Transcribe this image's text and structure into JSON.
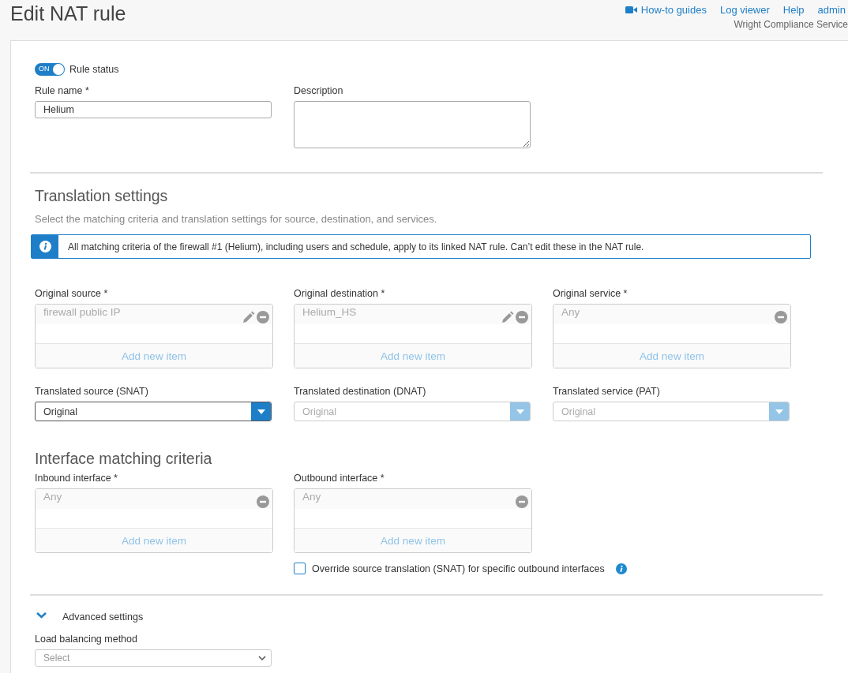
{
  "header": {
    "title": "Edit NAT rule",
    "links": [
      {
        "label": "How-to guides",
        "kind": "video"
      },
      {
        "label": "Log viewer",
        "kind": "plain"
      },
      {
        "label": "Help",
        "kind": "plain"
      },
      {
        "label": "admin",
        "kind": "plain"
      }
    ],
    "account": "Wright Compliance Service"
  },
  "rule_status": {
    "label": "Rule status",
    "toggle_text": "ON",
    "on": true
  },
  "rule_name": {
    "label": "Rule name *",
    "value": "Helium"
  },
  "description": {
    "label": "Description"
  },
  "translation": {
    "heading": "Translation settings",
    "subtitle": "Select the matching criteria and translation settings for source, destination, and services.",
    "notice": "All matching criteria of the firewall #1 (Helium), including users and schedule, apply to its linked NAT rule. Can’t edit these in the NAT rule.",
    "pickers": [
      {
        "label": "Original source *",
        "item": "firewall public IP",
        "editable": true,
        "add_label": "Add new item"
      },
      {
        "label": "Original destination *",
        "item": "Helium_HS",
        "editable": true,
        "add_label": "Add new item"
      },
      {
        "label": "Original service *",
        "item": "Any",
        "editable": false,
        "add_label": "Add new item"
      }
    ],
    "selects": [
      {
        "label": "Translated source (SNAT)",
        "value": "Original",
        "disabled": false
      },
      {
        "label": "Translated destination (DNAT)",
        "value": "Original",
        "disabled": true
      },
      {
        "label": "Translated service (PAT)",
        "value": "Original",
        "disabled": true
      }
    ]
  },
  "interface": {
    "heading": "Interface matching criteria",
    "pickers": [
      {
        "label": "Inbound interface *",
        "item": "Any",
        "editable": false,
        "add_label": "Add new item"
      },
      {
        "label": "Outbound interface *",
        "item": "Any",
        "editable": false,
        "add_label": "Add new item"
      }
    ],
    "override": {
      "label": "Override source translation (SNAT) for specific outbound interfaces",
      "checked": false
    }
  },
  "advanced": {
    "label": "Advanced settings",
    "expanded": true,
    "load_balancing": {
      "label": "Load balancing method",
      "placeholder": "Select"
    }
  }
}
